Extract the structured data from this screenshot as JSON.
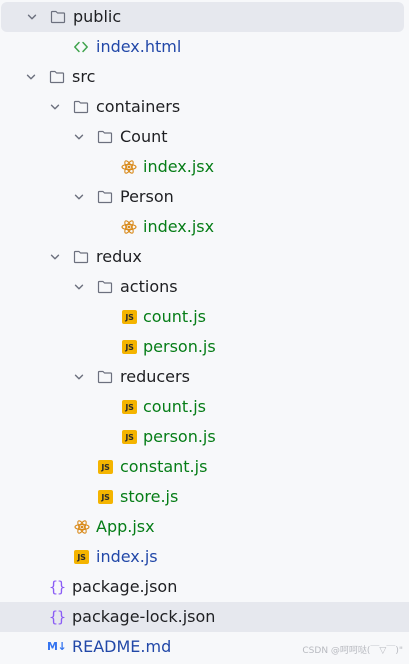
{
  "tree": {
    "public": "public",
    "public_index_html": "index.html",
    "src": "src",
    "containers": "containers",
    "count_folder": "Count",
    "count_index_jsx": "index.jsx",
    "person_folder": "Person",
    "person_index_jsx": "index.jsx",
    "redux": "redux",
    "actions": "actions",
    "actions_count_js": "count.js",
    "actions_person_js": "person.js",
    "reducers": "reducers",
    "reducers_count_js": "count.js",
    "reducers_person_js": "person.js",
    "constant_js": "constant.js",
    "store_js": "store.js",
    "app_jsx": "App.jsx",
    "src_index_js": "index.js",
    "package_json": "package.json",
    "package_lock_json": "package-lock.json",
    "readme_md": "README.md"
  },
  "badges": {
    "js": "JS",
    "json": "{}",
    "md": "M↓"
  },
  "watermark": "CSDN @呵呵哒(￣▽￣)\"",
  "colors": {
    "background": "#f7f8fa",
    "selected_row": "#e6e8ee",
    "label_dark": "#1e1f22",
    "label_green": "#067d17",
    "label_blue": "#2248a8",
    "js_badge": "#f4b400",
    "json_icon": "#8a5cf5",
    "react_icon": "#d98a1a",
    "html_icon": "#3fa34d",
    "md_icon": "#3574f0",
    "folder_outline": "#6c707e"
  }
}
